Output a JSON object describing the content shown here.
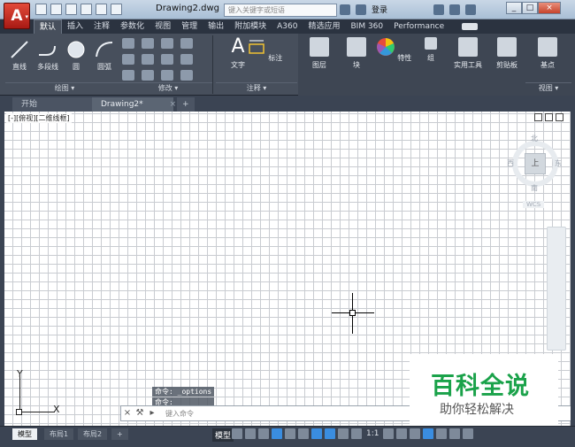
{
  "title_bar": {
    "app_button_letter": "A",
    "document_title": "Drawing2.dwg",
    "search_placeholder": "键入关键字或短语",
    "sign_in_label": "登录"
  },
  "ribbon_tabs": [
    "默认",
    "插入",
    "注释",
    "参数化",
    "视图",
    "管理",
    "输出",
    "附加模块",
    "A360",
    "精选应用",
    "BIM 360",
    "Performance"
  ],
  "ribbon": {
    "draw_tools": [
      "直线",
      "多段线",
      "圆",
      "圆弧"
    ],
    "text_tool": "文字",
    "dim_tool": "标注",
    "right_tools": [
      "图层",
      "块",
      "特性",
      "组",
      "实用工具",
      "剪贴板",
      "基点"
    ],
    "panel_footers": [
      "绘图 ▾",
      "修改 ▾",
      "注释 ▾",
      "视图 ▾"
    ]
  },
  "file_tabs": {
    "start": "开始",
    "drawing": "Drawing2*",
    "close": "×",
    "new": "+"
  },
  "viewport": {
    "label": "[-][俯视][二维线框]",
    "viewcube": {
      "north": "北",
      "south": "南",
      "east": "东",
      "west": "西",
      "face": "上",
      "wcs": "WCS"
    }
  },
  "ucs": {
    "y": "Y",
    "x": "X"
  },
  "command": {
    "history": [
      "命令: _options",
      "命令:"
    ],
    "placeholder": "键入命令"
  },
  "watermark": {
    "title": "百科全说",
    "subtitle": "助你轻松解决"
  },
  "layout_tabs": [
    "模型",
    "布局1",
    "布局2",
    "+"
  ],
  "status_bar": {
    "model_label": "模型",
    "scale": "1:1"
  }
}
